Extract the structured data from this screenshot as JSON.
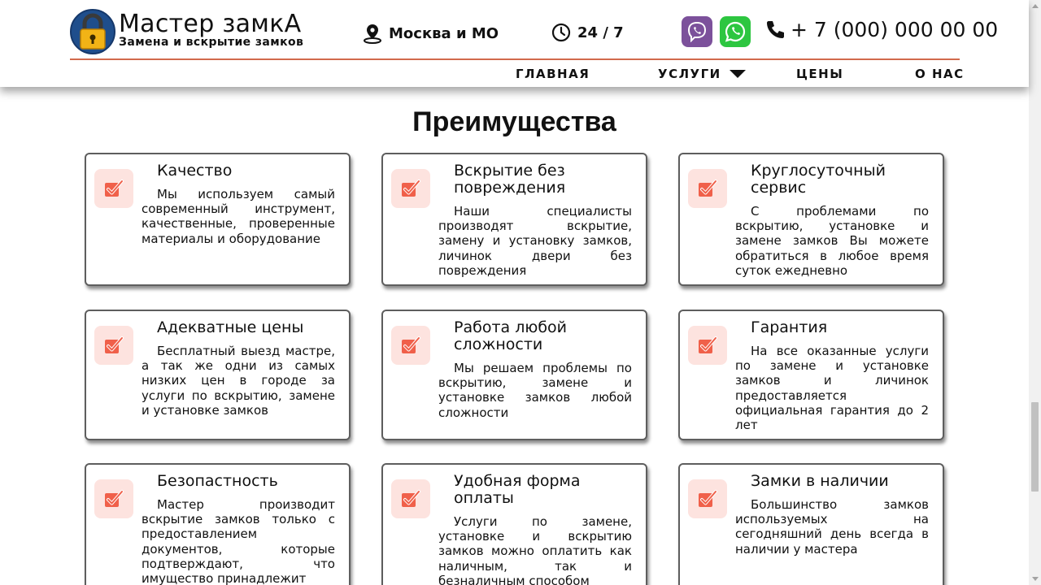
{
  "header": {
    "brand_name": "Мастер замкА",
    "brand_tagline": "Замена и вскрытие замков",
    "city": "Москва и МО",
    "hours": "24 / 7",
    "phone": "+ 7 (000) 000 00 00"
  },
  "nav": {
    "home": "ГЛАВНАЯ",
    "services": "УСЛУГИ",
    "prices": "ЦЕНЫ",
    "about": "О НАС"
  },
  "section": {
    "title": "Преимущества",
    "cards": [
      {
        "title": "Качество",
        "text": "Мы используем самый современный инструмент, качественные, проверенные материалы и оборудование"
      },
      {
        "title": "Вскрытие без повреждения",
        "text": "Наши специалисты производят вскрытие, замену и установку замков, личинок двери без повреждения"
      },
      {
        "title": "Круглосуточный сервис",
        "text": "С проблемами по вскрытию, установке и замене замков Вы можете обратиться в любое время суток ежедневно"
      },
      {
        "title": "Адекватные цены",
        "text": "Бесплатный выезд мастре, а так же одни из самых низких цен в городе за услуги по вскрытию, замене и установке замков"
      },
      {
        "title": "Работа любой сложности",
        "text": "Мы решаем проблемы по вскрытию, замене и установке замков любой сложности"
      },
      {
        "title": "Гарантия",
        "text": "На все оказанные услуги по замене и установке замков и личинок предоставляется официальная гарантия до 2 лет"
      },
      {
        "title": "Безопастность",
        "text": "Мастер производит вскрытие замков только с предоставлением документов, которые подтверждают, что имущество принадлежит"
      },
      {
        "title": "Удобная форма оплаты",
        "text": "Услуги по замене, установке и вскрытию замков можно оплатить как наличным, так и безналичным способом"
      },
      {
        "title": "Замки в наличии",
        "text": "Большинство замков используемых на сегодняшний день всегда в наличии у мастера"
      }
    ]
  },
  "colors": {
    "accent_line": "#d26a4c",
    "icon_bg": "#fde3df",
    "icon_check": "#f0604a",
    "viber": "#7c519b",
    "whatsapp": "#2dc640"
  }
}
